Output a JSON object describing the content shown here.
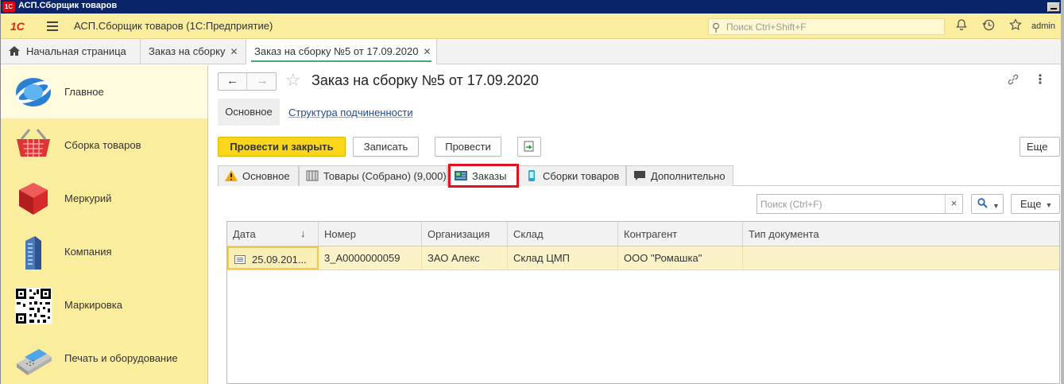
{
  "window": {
    "title": "АСП.Сборщик товаров",
    "logo_text": "1С"
  },
  "appbar": {
    "logo": "1С",
    "title": "АСП.Сборщик товаров  (1С:Предприятие)",
    "search_placeholder": "Поиск Ctrl+Shift+F",
    "user": "admin"
  },
  "open_tabs": [
    {
      "label": "Начальная страница",
      "closable": false
    },
    {
      "label": "Заказ на сборку",
      "closable": true
    },
    {
      "label": "Заказ на сборку №5 от 17.09.2020",
      "closable": true,
      "active": true
    }
  ],
  "sidebar": {
    "items": [
      {
        "label": "Главное",
        "icon": "globe-icon",
        "active": true
      },
      {
        "label": "Сборка товаров",
        "icon": "basket-icon"
      },
      {
        "label": "Меркурий",
        "icon": "cube-icon"
      },
      {
        "label": "Компания",
        "icon": "building-icon"
      },
      {
        "label": "Маркировка",
        "icon": "qr-code-icon"
      },
      {
        "label": "Печать и оборудование",
        "icon": "pos-terminal-icon"
      }
    ]
  },
  "form": {
    "title": "Заказ на сборку №5 от 17.09.2020",
    "panel": {
      "main": "Основное",
      "link": "Структура подчиненности"
    },
    "buttons": {
      "post_close": "Провести и закрыть",
      "save": "Записать",
      "post": "Провести",
      "more": "Еще"
    },
    "tabs": [
      {
        "label": "Основное",
        "icon": "warning-icon"
      },
      {
        "label": "Товары (Собрано) (9,000)",
        "icon": "products-icon"
      },
      {
        "label": "Заказы",
        "icon": "orders-icon",
        "active": true
      },
      {
        "label": "Сборки товаров",
        "icon": "phone-icon"
      },
      {
        "label": "Дополнительно",
        "icon": "comment-icon"
      }
    ],
    "list": {
      "search_placeholder": "Поиск (Ctrl+F)",
      "clear": "×",
      "more": "Еще",
      "columns": [
        "Дата",
        "Номер",
        "Организация",
        "Склад",
        "Контрагент",
        "Тип документа"
      ],
      "sort_indicator": "↓",
      "rows": [
        [
          "25.09.201...",
          "3_А0000000059",
          "ЗАО Алекс",
          "Склад ЦМП",
          "ООО \"Ромашка\"",
          ""
        ]
      ]
    }
  },
  "colors": {
    "accent_yellow": "#f9d619",
    "sidebar_bg": "#fbed9e",
    "highlight_red": "#e3111b",
    "active_tab_underline": "#4aa86a",
    "link_blue": "#1e4b97"
  }
}
